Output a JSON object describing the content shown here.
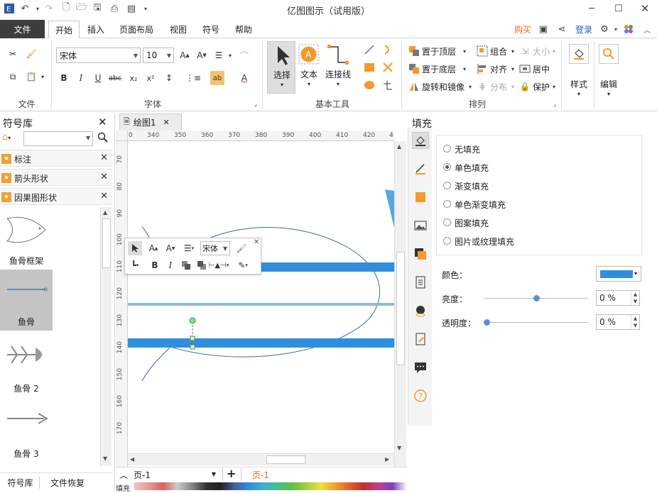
{
  "app": {
    "title": "亿图图示（试用版）"
  },
  "menu": {
    "file": "文件",
    "tabs": [
      "开始",
      "插入",
      "页面布局",
      "视图",
      "符号",
      "帮助"
    ],
    "buy": "购买",
    "login": "登录"
  },
  "ribbon": {
    "groups": {
      "file": "文件",
      "font": "字体",
      "basic_tools": "基本工具",
      "arrange": "排列"
    },
    "font_name": "宋体",
    "font_size": "10",
    "tools": {
      "select": "选择",
      "text": "文本",
      "connector": "连接线"
    },
    "arrange_items": [
      "置于顶层",
      "置于底层",
      "旋转和镜像",
      "组合",
      "对齐",
      "分布",
      "大小",
      "居中",
      "保护"
    ],
    "style": "样式",
    "edit": "编辑"
  },
  "symbol_lib": {
    "title": "符号库",
    "search_placeholder": "",
    "categories": [
      "标注",
      "箭头形状",
      "因果图形状"
    ],
    "shapes": [
      "鱼骨框架",
      "鱼骨",
      "鱼骨 2",
      "鱼骨 3"
    ],
    "bottom_tabs": [
      "符号库",
      "文件恢复"
    ]
  },
  "canvas": {
    "doc_tab": "绘图1",
    "ruler_h": [
      "0",
      "340",
      "350",
      "360",
      "370",
      "380",
      "390",
      "400",
      "410",
      "420",
      "4"
    ],
    "ruler_v": [
      "70",
      "80",
      "90",
      "100",
      "110",
      "120",
      "130",
      "140",
      "150",
      "160",
      "170"
    ],
    "page_select": "页-1",
    "page_tab": "页-1",
    "fill_label": "填充"
  },
  "floating_toolbar": {
    "font": "宋体"
  },
  "fill_panel": {
    "title": "填充",
    "options": [
      "无填充",
      "单色填充",
      "渐变填充",
      "单色渐变填充",
      "图案填充",
      "图片或纹理填充"
    ],
    "selected_option": "单色填充",
    "color_label": "颜色：",
    "color_value": "#2f8fdc",
    "brightness_label": "亮度：",
    "brightness_value": "0 %",
    "transparency_label": "透明度：",
    "transparency_value": "0 %"
  },
  "colors": {
    "accent": "#2f8fdc",
    "orange": "#f0a030",
    "file_bg": "#3d3d3d"
  }
}
